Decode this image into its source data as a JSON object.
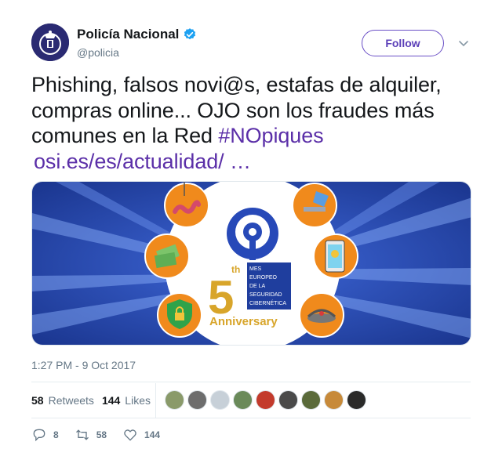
{
  "account": {
    "display_name": "Policía Nacional",
    "handle": "@policia",
    "verified": true,
    "avatar_icon": "police-badge-icon"
  },
  "follow_label": "Follow",
  "tweet": {
    "line1": "Phishing, falsos novi@s, estafas de alquiler,",
    "line2": "compras online... OJO  son los fraudes más",
    "line3_text": "comunes en la Red ",
    "hashtag": "#NOpiques",
    "link": "osi.es/es/actualidad/  …"
  },
  "media": {
    "banner_lines": [
      "MES",
      "EUROPEO",
      "DE LA",
      "SEGURIDAD",
      "CIBERNÉTICA"
    ],
    "big_number": "5",
    "ordinal": "th",
    "anniversary": "Anniversary",
    "colors": {
      "background": "#1f3e9e",
      "accent": "#f08a1c",
      "ring": "#ffffff",
      "gold": "#d8a52a"
    }
  },
  "timestamp": "1:27 PM - 9 Oct 2017",
  "stats": {
    "retweets_count": "58",
    "retweets_label": "Retweets",
    "likes_count": "144",
    "likes_label": "Likes"
  },
  "likers": [
    {
      "color": "#8a9a6a"
    },
    {
      "color": "#6d6d6d"
    },
    {
      "color": "#c7d0d8"
    },
    {
      "color": "#6a8a5a"
    },
    {
      "color": "#c33a2c"
    },
    {
      "color": "#4a4a4a"
    },
    {
      "color": "#5a6a3a"
    },
    {
      "color": "#c78a3a"
    },
    {
      "color": "#2a2a2a"
    }
  ],
  "actions": {
    "reply_count": "8",
    "retweet_count": "58",
    "like_count": "144"
  }
}
